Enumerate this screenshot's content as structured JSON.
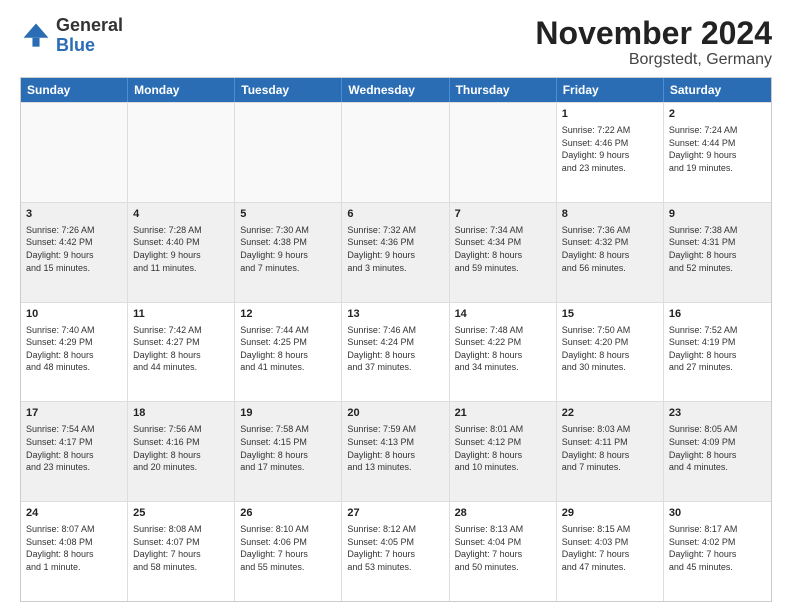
{
  "logo": {
    "general": "General",
    "blue": "Blue"
  },
  "title": {
    "month": "November 2024",
    "location": "Borgstedt, Germany"
  },
  "header_days": [
    "Sunday",
    "Monday",
    "Tuesday",
    "Wednesday",
    "Thursday",
    "Friday",
    "Saturday"
  ],
  "weeks": [
    [
      {
        "day": "",
        "text": "",
        "empty": true
      },
      {
        "day": "",
        "text": "",
        "empty": true
      },
      {
        "day": "",
        "text": "",
        "empty": true
      },
      {
        "day": "",
        "text": "",
        "empty": true
      },
      {
        "day": "",
        "text": "",
        "empty": true
      },
      {
        "day": "1",
        "text": "Sunrise: 7:22 AM\nSunset: 4:46 PM\nDaylight: 9 hours\nand 23 minutes.",
        "empty": false
      },
      {
        "day": "2",
        "text": "Sunrise: 7:24 AM\nSunset: 4:44 PM\nDaylight: 9 hours\nand 19 minutes.",
        "empty": false
      }
    ],
    [
      {
        "day": "3",
        "text": "Sunrise: 7:26 AM\nSunset: 4:42 PM\nDaylight: 9 hours\nand 15 minutes.",
        "empty": false
      },
      {
        "day": "4",
        "text": "Sunrise: 7:28 AM\nSunset: 4:40 PM\nDaylight: 9 hours\nand 11 minutes.",
        "empty": false
      },
      {
        "day": "5",
        "text": "Sunrise: 7:30 AM\nSunset: 4:38 PM\nDaylight: 9 hours\nand 7 minutes.",
        "empty": false
      },
      {
        "day": "6",
        "text": "Sunrise: 7:32 AM\nSunset: 4:36 PM\nDaylight: 9 hours\nand 3 minutes.",
        "empty": false
      },
      {
        "day": "7",
        "text": "Sunrise: 7:34 AM\nSunset: 4:34 PM\nDaylight: 8 hours\nand 59 minutes.",
        "empty": false
      },
      {
        "day": "8",
        "text": "Sunrise: 7:36 AM\nSunset: 4:32 PM\nDaylight: 8 hours\nand 56 minutes.",
        "empty": false
      },
      {
        "day": "9",
        "text": "Sunrise: 7:38 AM\nSunset: 4:31 PM\nDaylight: 8 hours\nand 52 minutes.",
        "empty": false
      }
    ],
    [
      {
        "day": "10",
        "text": "Sunrise: 7:40 AM\nSunset: 4:29 PM\nDaylight: 8 hours\nand 48 minutes.",
        "empty": false
      },
      {
        "day": "11",
        "text": "Sunrise: 7:42 AM\nSunset: 4:27 PM\nDaylight: 8 hours\nand 44 minutes.",
        "empty": false
      },
      {
        "day": "12",
        "text": "Sunrise: 7:44 AM\nSunset: 4:25 PM\nDaylight: 8 hours\nand 41 minutes.",
        "empty": false
      },
      {
        "day": "13",
        "text": "Sunrise: 7:46 AM\nSunset: 4:24 PM\nDaylight: 8 hours\nand 37 minutes.",
        "empty": false
      },
      {
        "day": "14",
        "text": "Sunrise: 7:48 AM\nSunset: 4:22 PM\nDaylight: 8 hours\nand 34 minutes.",
        "empty": false
      },
      {
        "day": "15",
        "text": "Sunrise: 7:50 AM\nSunset: 4:20 PM\nDaylight: 8 hours\nand 30 minutes.",
        "empty": false
      },
      {
        "day": "16",
        "text": "Sunrise: 7:52 AM\nSunset: 4:19 PM\nDaylight: 8 hours\nand 27 minutes.",
        "empty": false
      }
    ],
    [
      {
        "day": "17",
        "text": "Sunrise: 7:54 AM\nSunset: 4:17 PM\nDaylight: 8 hours\nand 23 minutes.",
        "empty": false
      },
      {
        "day": "18",
        "text": "Sunrise: 7:56 AM\nSunset: 4:16 PM\nDaylight: 8 hours\nand 20 minutes.",
        "empty": false
      },
      {
        "day": "19",
        "text": "Sunrise: 7:58 AM\nSunset: 4:15 PM\nDaylight: 8 hours\nand 17 minutes.",
        "empty": false
      },
      {
        "day": "20",
        "text": "Sunrise: 7:59 AM\nSunset: 4:13 PM\nDaylight: 8 hours\nand 13 minutes.",
        "empty": false
      },
      {
        "day": "21",
        "text": "Sunrise: 8:01 AM\nSunset: 4:12 PM\nDaylight: 8 hours\nand 10 minutes.",
        "empty": false
      },
      {
        "day": "22",
        "text": "Sunrise: 8:03 AM\nSunset: 4:11 PM\nDaylight: 8 hours\nand 7 minutes.",
        "empty": false
      },
      {
        "day": "23",
        "text": "Sunrise: 8:05 AM\nSunset: 4:09 PM\nDaylight: 8 hours\nand 4 minutes.",
        "empty": false
      }
    ],
    [
      {
        "day": "24",
        "text": "Sunrise: 8:07 AM\nSunset: 4:08 PM\nDaylight: 8 hours\nand 1 minute.",
        "empty": false
      },
      {
        "day": "25",
        "text": "Sunrise: 8:08 AM\nSunset: 4:07 PM\nDaylight: 7 hours\nand 58 minutes.",
        "empty": false
      },
      {
        "day": "26",
        "text": "Sunrise: 8:10 AM\nSunset: 4:06 PM\nDaylight: 7 hours\nand 55 minutes.",
        "empty": false
      },
      {
        "day": "27",
        "text": "Sunrise: 8:12 AM\nSunset: 4:05 PM\nDaylight: 7 hours\nand 53 minutes.",
        "empty": false
      },
      {
        "day": "28",
        "text": "Sunrise: 8:13 AM\nSunset: 4:04 PM\nDaylight: 7 hours\nand 50 minutes.",
        "empty": false
      },
      {
        "day": "29",
        "text": "Sunrise: 8:15 AM\nSunset: 4:03 PM\nDaylight: 7 hours\nand 47 minutes.",
        "empty": false
      },
      {
        "day": "30",
        "text": "Sunrise: 8:17 AM\nSunset: 4:02 PM\nDaylight: 7 hours\nand 45 minutes.",
        "empty": false
      }
    ]
  ]
}
